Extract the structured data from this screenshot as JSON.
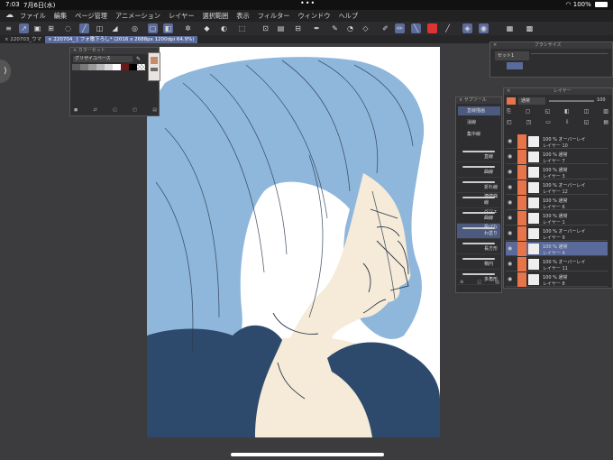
{
  "status": {
    "time": "7:03",
    "date": "7月6日(水)",
    "battery": "100%"
  },
  "menu": [
    "ファイル",
    "編集",
    "ページ管理",
    "アニメーション",
    "レイヤー",
    "選択範囲",
    "表示",
    "フィルター",
    "ウィンドウ",
    "ヘルプ"
  ],
  "tabs": {
    "first": "220703_ウマ",
    "active": "220704_ [ フォ歌下ろし* (2016 x 2688px 1200dpi 64.9%)"
  },
  "color_palette": {
    "title": "カラーセット",
    "set_name": "グリザイユベース"
  },
  "tool_panel": {
    "title": "サブツール",
    "groups": [
      "直線描画",
      "消線",
      "集中線"
    ],
    "brushes": [
      "直線",
      "曲線",
      "折れ線",
      "連続曲線",
      "ベジェ曲線",
      "投げなわ塗り",
      "長方形",
      "楕円",
      "多角形"
    ]
  },
  "layer_panel": {
    "title": "レイヤー",
    "blend_mode": "通常",
    "opacity": "100",
    "layers": [
      {
        "mode": "100 % オーバーレイ",
        "name": "レイヤー 10"
      },
      {
        "mode": "100 % 通常",
        "name": "レイヤー 7"
      },
      {
        "mode": "100 % 通常",
        "name": "レイヤー 3"
      },
      {
        "mode": "100 % オーバーレイ",
        "name": "レイヤー 12"
      },
      {
        "mode": "100 % 通常",
        "name": "レイヤー 6"
      },
      {
        "mode": "100 % 通常",
        "name": "レイヤー 1"
      },
      {
        "mode": "100 % オーバーレイ",
        "name": "レイヤー 9"
      },
      {
        "mode": "100 % 通常",
        "name": "レイヤー 4"
      },
      {
        "mode": "100 % オーバーレイ",
        "name": "レイヤー 11"
      },
      {
        "mode": "100 % 通常",
        "name": "レイヤー 8"
      }
    ]
  },
  "brush_size_panel": {
    "title": "ブラシサイズ",
    "set": "セット1"
  },
  "canvas_colors": {
    "hair": "#8fb7dc",
    "skin": "#f6ead8",
    "clothing": "#2d4a6d",
    "line": "#2a3a4e"
  },
  "palette_colors": [
    "#5a5a5a",
    "#7a7a7a",
    "#9a9a9a",
    "#b8b8b8",
    "#d8d8d8",
    "#ffffff",
    "#6a1a1a",
    "#000000"
  ]
}
